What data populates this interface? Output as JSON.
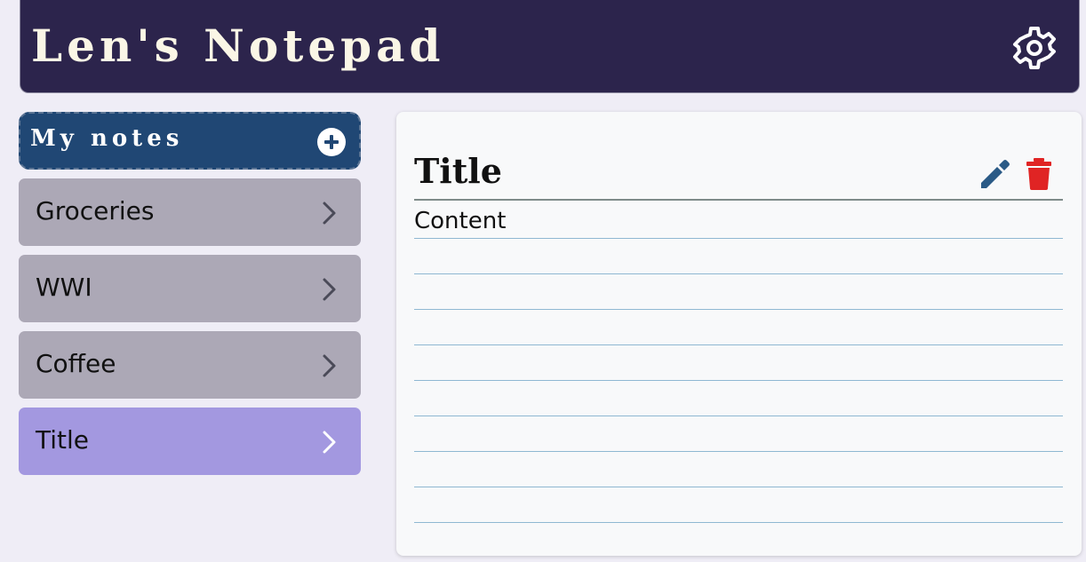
{
  "app": {
    "title": "Len's Notepad",
    "settings_icon": "gear-icon"
  },
  "sidebar": {
    "heading": "My notes",
    "add_icon": "plus-circle-icon",
    "items": [
      {
        "label": "Groceries",
        "active": false
      },
      {
        "label": "WWI",
        "active": false
      },
      {
        "label": "Coffee",
        "active": false
      },
      {
        "label": "Title",
        "active": true
      }
    ]
  },
  "note": {
    "title": "Title",
    "content": "Content",
    "edit_icon": "pencil-icon",
    "delete_icon": "trash-icon"
  },
  "colors": {
    "header_bg": "#2c244c",
    "sidebar_head_bg": "#204774",
    "item_bg": "#aca8b6",
    "item_active_bg": "#a398e0",
    "edit_icon": "#2a5a86",
    "delete_icon": "#e02424"
  }
}
